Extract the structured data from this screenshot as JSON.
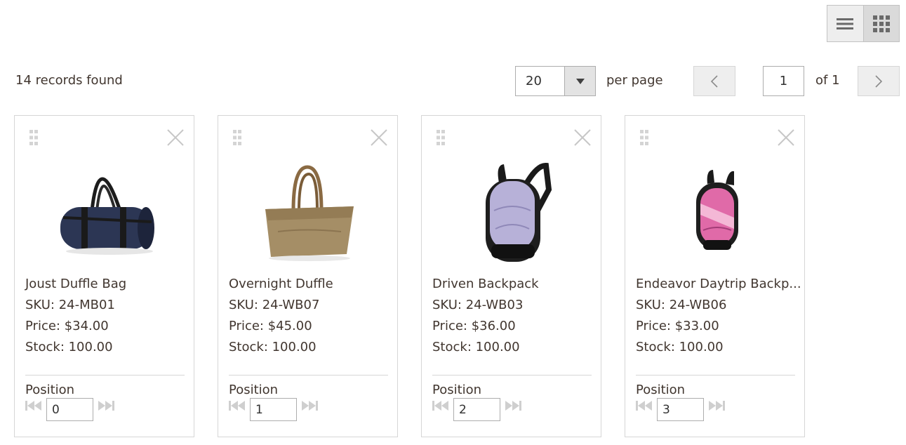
{
  "view_modes": {
    "list_icon": "list-icon",
    "grid_icon": "grid-icon",
    "active": "grid"
  },
  "toolbar": {
    "records_found": "14 records found",
    "per_page_value": "20",
    "per_page_label": "per page",
    "current_page": "1",
    "page_of": "of 1"
  },
  "products": [
    {
      "name": "Joust Duffle Bag",
      "sku": "SKU: 24-MB01",
      "price": "Price: $34.00",
      "stock": "Stock: 100.00",
      "position_label": "Position",
      "position": "0",
      "image": "navy-duffle-bag"
    },
    {
      "name": "Overnight Duffle",
      "sku": "SKU: 24-WB07",
      "price": "Price: $45.00",
      "stock": "Stock: 100.00",
      "position_label": "Position",
      "position": "1",
      "image": "tan-duffle-bag"
    },
    {
      "name": "Driven Backpack",
      "sku": "SKU: 24-WB03",
      "price": "Price: $36.00",
      "stock": "Stock: 100.00",
      "position_label": "Position",
      "position": "2",
      "image": "lavender-backpack"
    },
    {
      "name": "Endeavor Daytrip Backp...",
      "sku": "SKU: 24-WB06",
      "price": "Price: $33.00",
      "stock": "Stock: 100.00",
      "position_label": "Position",
      "position": "3",
      "image": "pink-backpack"
    }
  ],
  "colors": {
    "text": "#41362f",
    "border": "#d6d6d6",
    "icon_muted": "#c7c7c7",
    "button_bg": "#eeeeee"
  }
}
